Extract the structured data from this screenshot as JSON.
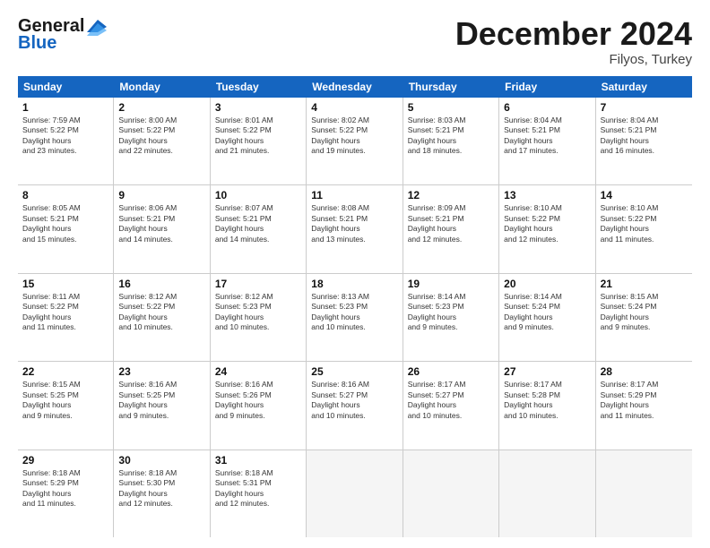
{
  "header": {
    "logo_line1": "General",
    "logo_line2": "Blue",
    "month_title": "December 2024",
    "location": "Filyos, Turkey"
  },
  "days_of_week": [
    "Sunday",
    "Monday",
    "Tuesday",
    "Wednesday",
    "Thursday",
    "Friday",
    "Saturday"
  ],
  "weeks": [
    [
      {
        "day": 1,
        "sunrise": "7:59 AM",
        "sunset": "5:22 PM",
        "daylight": "9 hours and 23 minutes."
      },
      {
        "day": 2,
        "sunrise": "8:00 AM",
        "sunset": "5:22 PM",
        "daylight": "9 hours and 22 minutes."
      },
      {
        "day": 3,
        "sunrise": "8:01 AM",
        "sunset": "5:22 PM",
        "daylight": "9 hours and 21 minutes."
      },
      {
        "day": 4,
        "sunrise": "8:02 AM",
        "sunset": "5:22 PM",
        "daylight": "9 hours and 19 minutes."
      },
      {
        "day": 5,
        "sunrise": "8:03 AM",
        "sunset": "5:21 PM",
        "daylight": "9 hours and 18 minutes."
      },
      {
        "day": 6,
        "sunrise": "8:04 AM",
        "sunset": "5:21 PM",
        "daylight": "9 hours and 17 minutes."
      },
      {
        "day": 7,
        "sunrise": "8:04 AM",
        "sunset": "5:21 PM",
        "daylight": "9 hours and 16 minutes."
      }
    ],
    [
      {
        "day": 8,
        "sunrise": "8:05 AM",
        "sunset": "5:21 PM",
        "daylight": "9 hours and 15 minutes."
      },
      {
        "day": 9,
        "sunrise": "8:06 AM",
        "sunset": "5:21 PM",
        "daylight": "9 hours and 14 minutes."
      },
      {
        "day": 10,
        "sunrise": "8:07 AM",
        "sunset": "5:21 PM",
        "daylight": "9 hours and 14 minutes."
      },
      {
        "day": 11,
        "sunrise": "8:08 AM",
        "sunset": "5:21 PM",
        "daylight": "9 hours and 13 minutes."
      },
      {
        "day": 12,
        "sunrise": "8:09 AM",
        "sunset": "5:21 PM",
        "daylight": "9 hours and 12 minutes."
      },
      {
        "day": 13,
        "sunrise": "8:10 AM",
        "sunset": "5:22 PM",
        "daylight": "9 hours and 12 minutes."
      },
      {
        "day": 14,
        "sunrise": "8:10 AM",
        "sunset": "5:22 PM",
        "daylight": "9 hours and 11 minutes."
      }
    ],
    [
      {
        "day": 15,
        "sunrise": "8:11 AM",
        "sunset": "5:22 PM",
        "daylight": "9 hours and 11 minutes."
      },
      {
        "day": 16,
        "sunrise": "8:12 AM",
        "sunset": "5:22 PM",
        "daylight": "9 hours and 10 minutes."
      },
      {
        "day": 17,
        "sunrise": "8:12 AM",
        "sunset": "5:23 PM",
        "daylight": "9 hours and 10 minutes."
      },
      {
        "day": 18,
        "sunrise": "8:13 AM",
        "sunset": "5:23 PM",
        "daylight": "9 hours and 10 minutes."
      },
      {
        "day": 19,
        "sunrise": "8:14 AM",
        "sunset": "5:23 PM",
        "daylight": "9 hours and 9 minutes."
      },
      {
        "day": 20,
        "sunrise": "8:14 AM",
        "sunset": "5:24 PM",
        "daylight": "9 hours and 9 minutes."
      },
      {
        "day": 21,
        "sunrise": "8:15 AM",
        "sunset": "5:24 PM",
        "daylight": "9 hours and 9 minutes."
      }
    ],
    [
      {
        "day": 22,
        "sunrise": "8:15 AM",
        "sunset": "5:25 PM",
        "daylight": "9 hours and 9 minutes."
      },
      {
        "day": 23,
        "sunrise": "8:16 AM",
        "sunset": "5:25 PM",
        "daylight": "9 hours and 9 minutes."
      },
      {
        "day": 24,
        "sunrise": "8:16 AM",
        "sunset": "5:26 PM",
        "daylight": "9 hours and 9 minutes."
      },
      {
        "day": 25,
        "sunrise": "8:16 AM",
        "sunset": "5:27 PM",
        "daylight": "9 hours and 10 minutes."
      },
      {
        "day": 26,
        "sunrise": "8:17 AM",
        "sunset": "5:27 PM",
        "daylight": "9 hours and 10 minutes."
      },
      {
        "day": 27,
        "sunrise": "8:17 AM",
        "sunset": "5:28 PM",
        "daylight": "9 hours and 10 minutes."
      },
      {
        "day": 28,
        "sunrise": "8:17 AM",
        "sunset": "5:29 PM",
        "daylight": "9 hours and 11 minutes."
      }
    ],
    [
      {
        "day": 29,
        "sunrise": "8:18 AM",
        "sunset": "5:29 PM",
        "daylight": "9 hours and 11 minutes."
      },
      {
        "day": 30,
        "sunrise": "8:18 AM",
        "sunset": "5:30 PM",
        "daylight": "9 hours and 12 minutes."
      },
      {
        "day": 31,
        "sunrise": "8:18 AM",
        "sunset": "5:31 PM",
        "daylight": "9 hours and 12 minutes."
      },
      null,
      null,
      null,
      null
    ]
  ]
}
